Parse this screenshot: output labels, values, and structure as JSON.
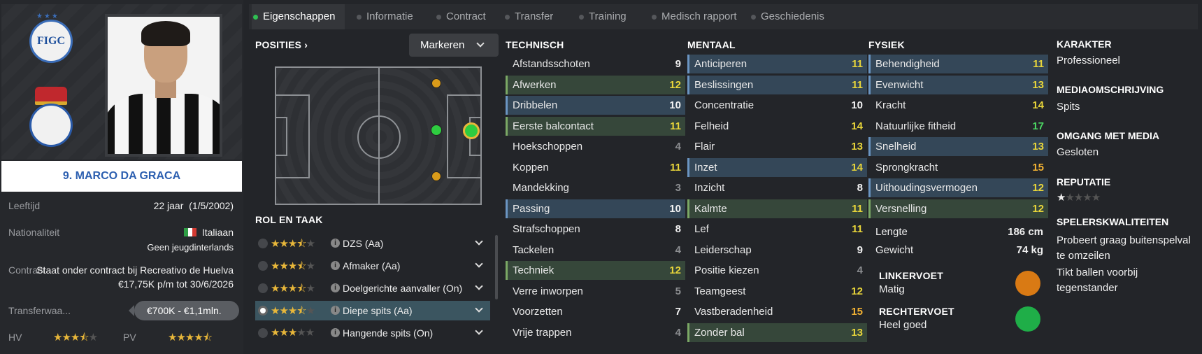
{
  "player": {
    "name": "9. MARCO DA GRACA",
    "labels": {
      "age": "Leeftijd",
      "nationality": "Nationaliteit",
      "contract": "Contract",
      "transfer": "Transferwaa...",
      "hv": "HV",
      "pv": "PV"
    },
    "age": "22 jaar",
    "birthdate": "(1/5/2002)",
    "nationality": "Italiaan",
    "youth": "Geen jeugdinterlands",
    "contract_line1": "Staat onder contract bij Recreativo de Huelva",
    "contract_line2": "€17,75K p/m tot 30/6/2026",
    "transfer_value": "€700K - €1,1mln.",
    "hv_stars": 3.5,
    "pv_stars": 4.5,
    "badge_text": "FIGC",
    "flag_colors": [
      "#2f9e45",
      "#ffffff",
      "#d33a32"
    ]
  },
  "tabs": [
    "Eigenschappen",
    "Informatie",
    "Contract",
    "Transfer",
    "Training",
    "Medisch rapport",
    "Geschiedenis"
  ],
  "positions": {
    "title": "POSITIES",
    "button": "Markeren"
  },
  "roles": {
    "title": "ROL EN TAAK",
    "items": [
      {
        "label": "DZS (Aa)",
        "stars": 3.5
      },
      {
        "label": "Afmaker (Aa)",
        "stars": 3.5
      },
      {
        "label": "Doelgerichte aanvaller (On)",
        "stars": 3.5
      },
      {
        "label": "Diepe spits (Aa)",
        "stars": 3.5
      },
      {
        "label": "Hangende spits (On)",
        "stars": 3
      }
    ]
  },
  "technisch": {
    "title": "TECHNISCH",
    "items": [
      {
        "name": "Afstandsschoten",
        "value": "9",
        "hl": "",
        "color": "white"
      },
      {
        "name": "Afwerken",
        "value": "12",
        "hl": "g",
        "color": "yellow"
      },
      {
        "name": "Dribbelen",
        "value": "10",
        "hl": "b",
        "color": "white"
      },
      {
        "name": "Eerste balcontact",
        "value": "11",
        "hl": "g",
        "color": "yellow"
      },
      {
        "name": "Hoekschoppen",
        "value": "4",
        "hl": "",
        "color": "grey"
      },
      {
        "name": "Koppen",
        "value": "11",
        "hl": "",
        "color": "yellow"
      },
      {
        "name": "Mandekking",
        "value": "3",
        "hl": "",
        "color": "grey"
      },
      {
        "name": "Passing",
        "value": "10",
        "hl": "b",
        "color": "white"
      },
      {
        "name": "Strafschoppen",
        "value": "8",
        "hl": "",
        "color": "white"
      },
      {
        "name": "Tackelen",
        "value": "4",
        "hl": "",
        "color": "grey"
      },
      {
        "name": "Techniek",
        "value": "12",
        "hl": "g",
        "color": "yellow"
      },
      {
        "name": "Verre inworpen",
        "value": "5",
        "hl": "",
        "color": "grey"
      },
      {
        "name": "Voorzetten",
        "value": "7",
        "hl": "",
        "color": "white"
      },
      {
        "name": "Vrije trappen",
        "value": "4",
        "hl": "",
        "color": "grey"
      }
    ]
  },
  "mentaal": {
    "title": "MENTAAL",
    "items": [
      {
        "name": "Anticiperen",
        "value": "11",
        "hl": "b",
        "color": "yellow"
      },
      {
        "name": "Beslissingen",
        "value": "11",
        "hl": "b",
        "color": "yellow"
      },
      {
        "name": "Concentratie",
        "value": "10",
        "hl": "",
        "color": "white"
      },
      {
        "name": "Felheid",
        "value": "14",
        "hl": "",
        "color": "yellow"
      },
      {
        "name": "Flair",
        "value": "13",
        "hl": "",
        "color": "yellow"
      },
      {
        "name": "Inzet",
        "value": "14",
        "hl": "b",
        "color": "yellow"
      },
      {
        "name": "Inzicht",
        "value": "8",
        "hl": "",
        "color": "white"
      },
      {
        "name": "Kalmte",
        "value": "11",
        "hl": "g",
        "color": "yellow"
      },
      {
        "name": "Lef",
        "value": "11",
        "hl": "",
        "color": "yellow"
      },
      {
        "name": "Leiderschap",
        "value": "9",
        "hl": "",
        "color": "white"
      },
      {
        "name": "Positie kiezen",
        "value": "4",
        "hl": "",
        "color": "grey"
      },
      {
        "name": "Teamgeest",
        "value": "12",
        "hl": "",
        "color": "yellow"
      },
      {
        "name": "Vastberadenheid",
        "value": "15",
        "hl": "",
        "color": "orange"
      },
      {
        "name": "Zonder bal",
        "value": "13",
        "hl": "g",
        "color": "yellow"
      }
    ]
  },
  "fysiek": {
    "title": "FYSIEK",
    "items": [
      {
        "name": "Behendigheid",
        "value": "11",
        "hl": "b",
        "color": "yellow"
      },
      {
        "name": "Evenwicht",
        "value": "13",
        "hl": "b",
        "color": "yellow"
      },
      {
        "name": "Kracht",
        "value": "14",
        "hl": "",
        "color": "yellow"
      },
      {
        "name": "Natuurlijke fitheid",
        "value": "17",
        "hl": "",
        "color": "green"
      },
      {
        "name": "Snelheid",
        "value": "13",
        "hl": "b",
        "color": "yellow"
      },
      {
        "name": "Sprongkracht",
        "value": "15",
        "hl": "",
        "color": "orange"
      },
      {
        "name": "Uithoudingsvermogen",
        "value": "12",
        "hl": "b",
        "color": "yellow"
      },
      {
        "name": "Versnelling",
        "value": "12",
        "hl": "g",
        "color": "yellow"
      }
    ],
    "lengte_label": "Lengte",
    "lengte": "186 cm",
    "gewicht_label": "Gewicht",
    "gewicht": "74 kg",
    "linkervoet_label": "LINKERVOET",
    "linkervoet": "Matig",
    "rechtervoet_label": "RECHTERVOET",
    "rechtervoet": "Heel goed"
  },
  "right": {
    "karakter_label": "KARAKTER",
    "karakter": "Professioneel",
    "media_label": "MEDIAOMSCHRIJVING",
    "media": "Spits",
    "omgang_label": "OMGANG MET MEDIA",
    "omgang": "Gesloten",
    "reputatie_label": "REPUTATIE",
    "reputatie_stars": 1,
    "kwaliteiten_label": "SPELERSKWALITEITEN",
    "kwaliteiten": [
      "Probeert graag buitenspelval te omzeilen",
      "Tikt ballen voorbij tegenstander"
    ]
  },
  "colors": {
    "green_dot": "#2ecc40",
    "yellow_dot": "#d99b1a",
    "left_foot": "#d97a14",
    "right_foot": "#1fae48"
  }
}
